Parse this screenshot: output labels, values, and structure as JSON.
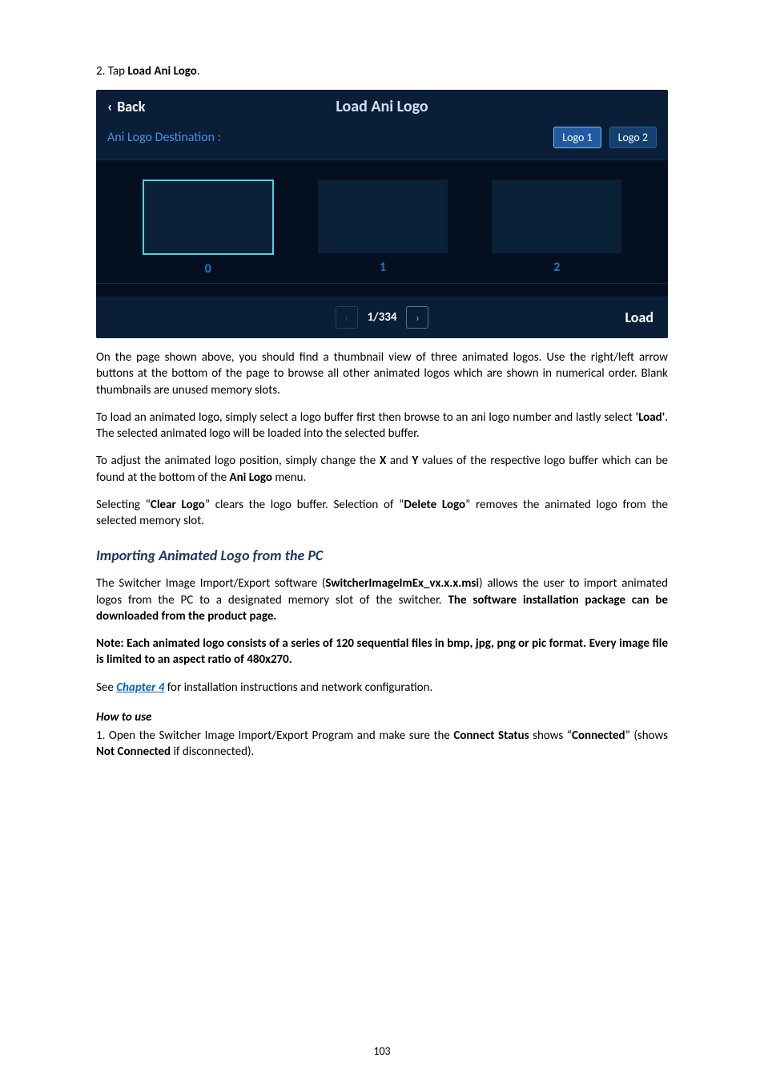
{
  "step2_prefix": "2. Tap ",
  "step2_bold": "Load Ani Logo",
  "step2_suffix": ".",
  "ui": {
    "back_label": "Back",
    "title": "Load Ani Logo",
    "dest_label": "Ani Logo Destination :",
    "logo1_label": "Logo 1",
    "logo2_label": "Logo 2",
    "thumbs": [
      "0",
      "1",
      "2"
    ],
    "pager_text": "1/334",
    "load_label": "Load"
  },
  "para1_parts": [
    "On the page shown above, you should find a thumbnail view of three animated logos. Use the right/left arrow buttons at the bottom of the page to browse all other animated logos which are shown in numerical order. Blank thumbnails are unused memory slots."
  ],
  "para2_pre": "To load an animated logo, simply select a logo buffer first then browse to an ani logo number and lastly select ",
  "para2_bold": "'Load'",
  "para2_post": ". The selected animated logo will be loaded into the selected buffer.",
  "para3_pre": "To adjust the animated logo position, simply change the ",
  "para3_x": "X",
  "para3_mid1": " and ",
  "para3_y": "Y",
  "para3_mid2": " values of the respective logo buffer which can be found at the bottom of the ",
  "para3_ani": "Ani Logo",
  "para3_post": " menu.",
  "para4_pre": "Selecting “",
  "para4_clear": "Clear Logo",
  "para4_mid": "” clears the logo buffer. Selection of “",
  "para4_delete": "Delete Logo",
  "para4_post": "” removes the animated logo from the selected memory slot.",
  "heading_import": "Importing Animated Logo from the PC",
  "para5_pre": "The Switcher Image Import/Export software (",
  "para5_msi": "SwitcherImageImEx_vx.x.x.msi",
  "para5_mid": ") allows the user to import animated logos from the PC to a designated memory slot of the switcher. ",
  "para5_bold_tail": "The software installation package can be downloaded from the product page.",
  "note_text": "Note: Each animated logo consists of a series of 120 sequential files in bmp, jpg, png or pic format. Every image file is limited to an aspect ratio of 480x270.",
  "see_pre": "See ",
  "see_link": "Chapter 4",
  "see_post": " for installation instructions and network configuration.",
  "howto_label": "How to use",
  "step1_pre": "1. Open the Switcher Image Import/Export Program and make sure the ",
  "step1_cs": "Connect Status",
  "step1_mid1": " shows “",
  "step1_connected": "Connected",
  "step1_mid2": "” (shows ",
  "step1_notconnected": "Not Connected",
  "step1_post": " if disconnected).",
  "page_number": "103"
}
